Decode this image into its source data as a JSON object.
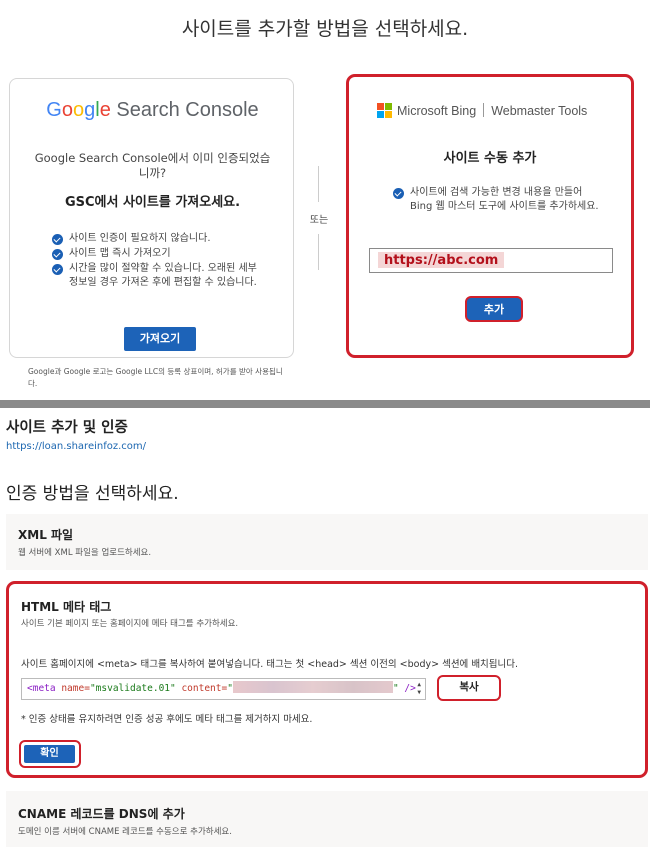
{
  "top": {
    "title": "사이트를 추가할 방법을 선택하세요.",
    "gsc": {
      "logo_google": [
        "G",
        "o",
        "o",
        "g",
        "l",
        "e"
      ],
      "logo_rest": " Search Console",
      "question": "Google Search Console에서 이미 인증되었습니까?",
      "heading": "GSC에서 사이트를 가져오세요.",
      "benefits": [
        "사이트 인증이 필요하지 않습니다.",
        "사이트 맵 즉시 가져오기",
        "시간을 많이 절약할 수 있습니다. 오래된 세부 정보일 경우 가져온 후에 편집할 수 있습니다."
      ],
      "import_button": "가져오기",
      "footnote": "Google과 Google 로고는 Google LLC의 등록 상표이며, 허가를 받아 사용됩니다."
    },
    "or_label": "또는",
    "bing": {
      "brand_left": "Microsoft Bing",
      "brand_right": "Webmaster Tools",
      "logo_colors": [
        "#f25022",
        "#7fba00",
        "#00a4ef",
        "#ffb900"
      ],
      "heading": "사이트 수동 추가",
      "description": "사이트에 검색 가능한 변경 내용을 만들어 Bing 웹 마스터 도구에 사이트를 추가하세요.",
      "url_value": "https://abc.com",
      "add_button": "추가"
    }
  },
  "bottom": {
    "title": "사이트 추가 및 인증",
    "site_url": "https://loan.shareinfoz.com/",
    "choose_heading": "인증 방법을 선택하세요.",
    "xml": {
      "title": "XML 파일",
      "subtitle": "웹 서버에 XML 파일을 업로드하세요."
    },
    "html_meta": {
      "title": "HTML 메타 태그",
      "subtitle": "사이트 기본 페이지 또는 홈페이지에 메타 태그를 추가하세요.",
      "instruction": "사이트 홈페이지에 <meta> 태그를 복사하여 붙여넣습니다. 태그는 첫 <head> 섹션 이전의 <body> 섹션에 배치됩니다.",
      "code_open": "<meta",
      "code_name_attr": " name=",
      "code_name_val": "\"msvalidate.01\"",
      "code_content_attr": " content=",
      "code_quote_open": "\"",
      "code_quote_close": "\"",
      "code_close": " />",
      "copy_button": "복사",
      "note": "* 인증 상태를 유지하려면 인증 성공 후에도 메타 태그를 제거하지 마세요.",
      "confirm_button": "확인"
    },
    "cname": {
      "title": "CNAME 레코드를 DNS에 추가",
      "subtitle": "도메인 이름 서버에 CNAME 레코드를 수동으로 추가하세요."
    }
  },
  "colors": {
    "highlight_red": "#d0202b",
    "primary_blue": "#1d63b8",
    "link_blue": "#1b66b0"
  }
}
